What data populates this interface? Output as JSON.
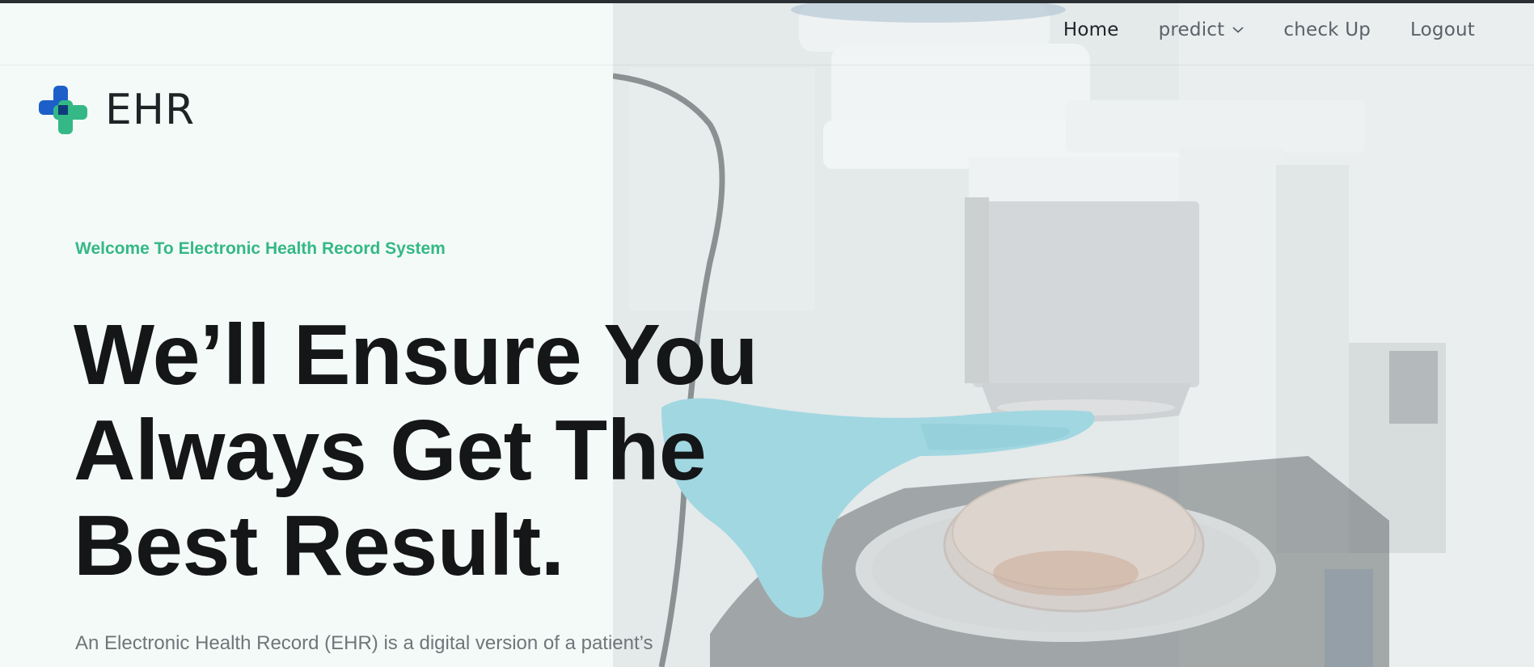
{
  "nav": {
    "home": "Home",
    "predict": "predict",
    "checkup": "check Up",
    "logout": "Logout"
  },
  "logo": {
    "text": "EHR",
    "icon": "medical-cross-icon",
    "colors": {
      "blue": "#1d5fc9",
      "green": "#34b886",
      "overlap": "#0f3b7a"
    }
  },
  "hero": {
    "eyebrow": "Welcome To Electronic Health Record System",
    "headline_lines": [
      "We’ll Ensure You",
      "Always Get The",
      "Best Result."
    ],
    "description": "An Electronic Health Record (EHR) is a digital version of a patient’s",
    "image": "microscope-petri-dish-photo"
  },
  "colors": {
    "accent": "#34b886",
    "heading": "#151617",
    "background": "#f4faf8"
  }
}
